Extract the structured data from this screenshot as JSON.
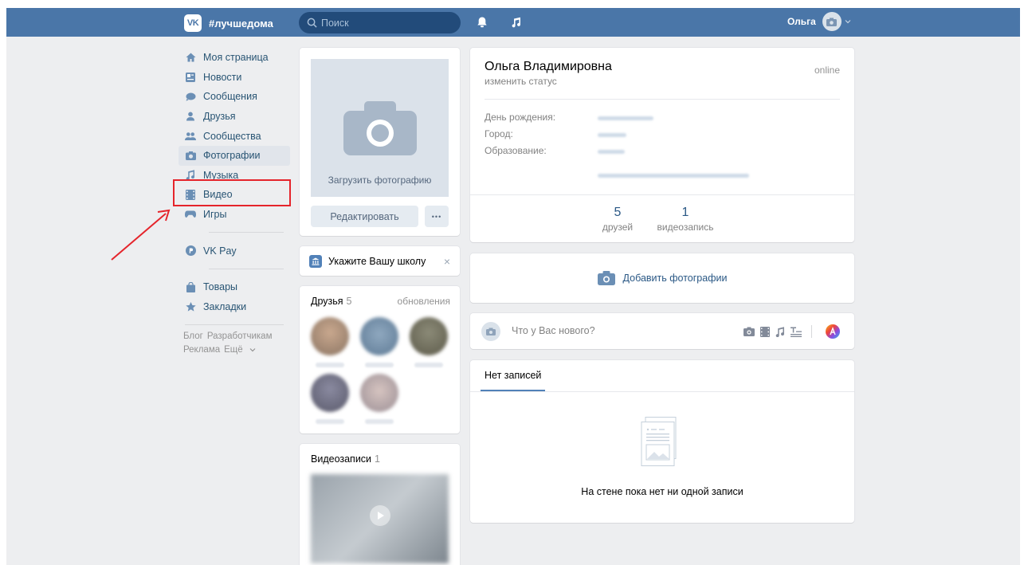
{
  "header": {
    "logo_icon": "vk-logo-icon",
    "logo_text": "VK",
    "hashtag": "#лучшедома",
    "search_placeholder": "Поиск",
    "user_name": "Ольга",
    "icons": [
      "bell-icon",
      "music-icon",
      "camera-icon",
      "chevron-down-icon"
    ]
  },
  "nav": {
    "items": [
      {
        "label": "Моя страница",
        "icon": "home-icon"
      },
      {
        "label": "Новости",
        "icon": "news-icon"
      },
      {
        "label": "Сообщения",
        "icon": "messages-icon"
      },
      {
        "label": "Друзья",
        "icon": "friends-icon"
      },
      {
        "label": "Сообщества",
        "icon": "communities-icon"
      },
      {
        "label": "Фотографии",
        "icon": "photo-icon"
      },
      {
        "label": "Музыка",
        "icon": "music-icon"
      },
      {
        "label": "Видео",
        "icon": "video-icon"
      },
      {
        "label": "Игры",
        "icon": "games-icon"
      }
    ],
    "vkpay": "VK Pay",
    "extra": [
      {
        "label": "Товары",
        "icon": "bag-icon"
      },
      {
        "label": "Закладки",
        "icon": "star-icon"
      }
    ],
    "footer": {
      "blog": "Блог",
      "devs": "Разработчикам",
      "ads": "Реклама",
      "more": "Ещё"
    }
  },
  "profile_photo": {
    "upload_label": "Загрузить фотографию",
    "edit_button": "Редактировать",
    "more_button": "•••"
  },
  "school_card": {
    "text": "Укажите Вашу школу",
    "close": "×"
  },
  "friends_card": {
    "title": "Друзья",
    "count": "5",
    "updates": "обновления"
  },
  "videos_card": {
    "title": "Видеозаписи",
    "count": "1"
  },
  "profile": {
    "name": "Ольга Владимировна",
    "status_link": "изменить статус",
    "online": "online",
    "info": [
      {
        "label": "День рождения:"
      },
      {
        "label": "Город:"
      },
      {
        "label": "Образование:"
      }
    ],
    "counters": [
      {
        "num": "5",
        "label": "друзей"
      },
      {
        "num": "1",
        "label": "видеозапись"
      }
    ]
  },
  "add_photos": {
    "label": "Добавить фотографии"
  },
  "composer": {
    "placeholder": "Что у Вас нового?"
  },
  "wall": {
    "tab": "Нет записей",
    "empty": "На стене пока нет ни одной записи"
  },
  "colors": {
    "header": "#4a76a8",
    "accent": "#5181b8",
    "highlight": "#e5242b"
  }
}
